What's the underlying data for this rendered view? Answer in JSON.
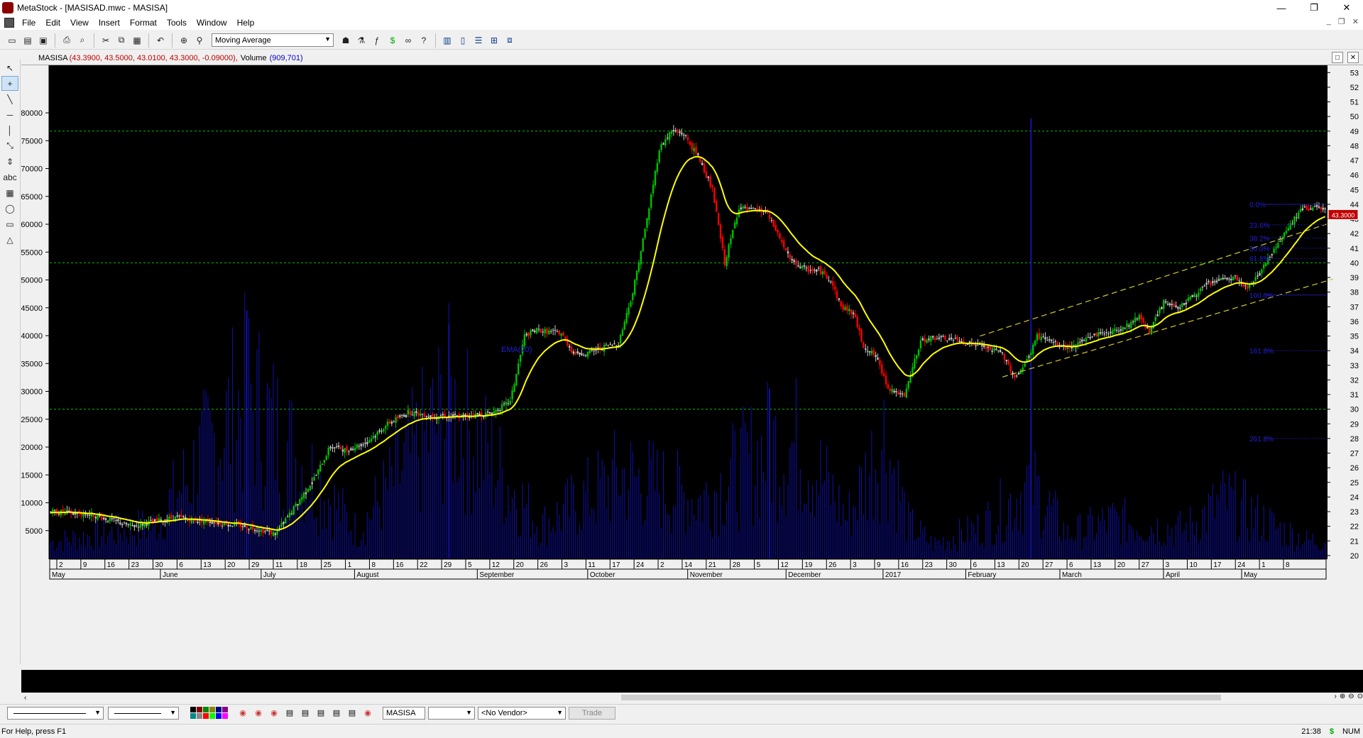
{
  "window": {
    "title": "MetaStock - [MASISAD.mwc - MASISA]",
    "controls": {
      "minimize": "—",
      "restore": "❐",
      "close": "✕"
    },
    "mdi_controls": [
      "_",
      "❐",
      "✕"
    ]
  },
  "menu": [
    "File",
    "Edit",
    "View",
    "Insert",
    "Format",
    "Tools",
    "Window",
    "Help"
  ],
  "toolbar": {
    "indicator_selected": "Moving Average",
    "buttons": [
      "new-icon",
      "open-icon",
      "save-icon",
      "print-icon",
      "print-preview-icon",
      "cut-icon",
      "copy-icon",
      "paste-icon",
      "undo-icon",
      "crosshair-icon",
      "zoom-icon",
      "expert-icon",
      "explorer-icon",
      "formula-icon",
      "dollar-icon",
      "binoculars-icon",
      "help-pointer-icon",
      "tile-icon",
      "window-split-icon",
      "window-horizontal-icon",
      "window-grid-icon",
      "window-cascade-icon"
    ]
  },
  "chart_header": {
    "symbol": "MASISA",
    "ohlc": "(43.3900, 43.5000, 43.0100, 43.3000, -0.09000),",
    "volume_label": "Volume",
    "volume_value": "(909,701)"
  },
  "chart_data": {
    "type": "candlestick",
    "symbol": "MASISA",
    "last_price_tag": "43.3000",
    "price_axis": {
      "ticks": [
        "53",
        "52",
        "51",
        "50",
        "49",
        "48",
        "47",
        "46",
        "45",
        "44",
        "43",
        "42",
        "41",
        "40",
        "39",
        "38",
        "37",
        "36",
        "35",
        "34",
        "33",
        "32",
        "31",
        "30",
        "29",
        "28",
        "27",
        "26",
        "25",
        "24",
        "23",
        "22",
        "21",
        "20"
      ]
    },
    "volume_axis": {
      "ticks": [
        "80000",
        "75000",
        "70000",
        "65000",
        "60000",
        "55000",
        "50000",
        "45000",
        "40000",
        "35000",
        "30000",
        "25000",
        "20000",
        "15000",
        "10000",
        "5000"
      ]
    },
    "horizontal_lines": [
      49,
      40,
      30
    ],
    "indicator_label": "EMA(20)",
    "fibonacci": [
      {
        "label": "0.0%",
        "value": 44.0
      },
      {
        "label": "23.6%",
        "value": 42.6
      },
      {
        "label": "38.2%",
        "value": 41.7
      },
      {
        "label": "50.0%",
        "value": 41.0
      },
      {
        "label": "61.8%",
        "value": 40.3
      },
      {
        "label": "100.0%",
        "value": 37.8
      },
      {
        "label": "161.8%",
        "value": 34.0
      },
      {
        "label": "261.8%",
        "value": 28.0
      }
    ],
    "x_axis": {
      "day_ticks": [
        "2",
        "9",
        "16",
        "23",
        "30",
        "6",
        "13",
        "20",
        "29",
        "11",
        "18",
        "25",
        "1",
        "8",
        "16",
        "22",
        "29",
        "5",
        "12",
        "20",
        "26",
        "3",
        "11",
        "17",
        "24",
        "2",
        "14",
        "21",
        "28",
        "5",
        "12",
        "19",
        "26",
        "3",
        "9",
        "16",
        "23",
        "30",
        "6",
        "13",
        "20",
        "27",
        "6",
        "13",
        "20",
        "27",
        "3",
        "10",
        "17",
        "24",
        "1",
        "8"
      ],
      "month_labels": [
        "May",
        "June",
        "July",
        "August",
        "September",
        "October",
        "November",
        "December",
        "2017",
        "February",
        "March",
        "April",
        "May"
      ]
    },
    "price_anchors": [
      [
        0,
        23.0
      ],
      [
        20,
        22.8
      ],
      [
        40,
        22.0
      ],
      [
        60,
        22.6
      ],
      [
        80,
        22.3
      ],
      [
        95,
        22.0
      ],
      [
        110,
        21.5
      ],
      [
        118,
        23.0
      ],
      [
        130,
        25.5
      ],
      [
        137,
        27.5
      ],
      [
        145,
        27.2
      ],
      [
        155,
        27.8
      ],
      [
        165,
        29.0
      ],
      [
        175,
        29.8
      ],
      [
        185,
        29.6
      ],
      [
        200,
        29.5
      ],
      [
        215,
        29.7
      ],
      [
        225,
        30.5
      ],
      [
        232,
        35.0
      ],
      [
        238,
        35.4
      ],
      [
        250,
        35.2
      ],
      [
        256,
        33.8
      ],
      [
        262,
        33.8
      ],
      [
        272,
        34.3
      ],
      [
        278,
        34.5
      ],
      [
        285,
        38.0
      ],
      [
        292,
        43.0
      ],
      [
        298,
        47.8
      ],
      [
        304,
        49.0
      ],
      [
        310,
        48.8
      ],
      [
        318,
        47.0
      ],
      [
        324,
        45.0
      ],
      [
        330,
        40.0
      ],
      [
        337,
        43.8
      ],
      [
        342,
        43.6
      ],
      [
        350,
        43.5
      ],
      [
        356,
        42.0
      ],
      [
        362,
        40.2
      ],
      [
        370,
        39.5
      ],
      [
        376,
        39.5
      ],
      [
        382,
        38.8
      ],
      [
        387,
        37.0
      ],
      [
        393,
        36.6
      ],
      [
        398,
        34.3
      ],
      [
        404,
        33.6
      ],
      [
        410,
        31.5
      ],
      [
        418,
        30.8
      ],
      [
        423,
        33.3
      ],
      [
        426,
        34.6
      ],
      [
        430,
        34.9
      ],
      [
        440,
        34.8
      ],
      [
        450,
        34.5
      ],
      [
        458,
        34.2
      ],
      [
        466,
        33.8
      ],
      [
        472,
        32.2
      ],
      [
        477,
        33.0
      ],
      [
        483,
        35.0
      ],
      [
        490,
        34.6
      ],
      [
        497,
        34.2
      ],
      [
        503,
        34.4
      ],
      [
        510,
        35.1
      ],
      [
        520,
        35.3
      ],
      [
        528,
        35.8
      ],
      [
        533,
        36.4
      ],
      [
        538,
        35.3
      ],
      [
        545,
        37.3
      ],
      [
        552,
        37.0
      ],
      [
        560,
        37.8
      ],
      [
        567,
        38.6
      ],
      [
        572,
        38.8
      ],
      [
        580,
        39.0
      ],
      [
        586,
        38.2
      ],
      [
        594,
        39.8
      ],
      [
        600,
        41.2
      ],
      [
        606,
        42.4
      ],
      [
        612,
        43.6
      ],
      [
        618,
        43.8
      ],
      [
        624,
        43.6
      ]
    ],
    "volume_anchors": [
      [
        0,
        4500
      ],
      [
        50,
        9000
      ],
      [
        96,
        44500
      ],
      [
        150,
        7500
      ],
      [
        195,
        42000
      ],
      [
        240,
        9000
      ],
      [
        280,
        23000
      ],
      [
        318,
        16000
      ],
      [
        352,
        30500
      ],
      [
        368,
        31000
      ],
      [
        390,
        11000
      ],
      [
        408,
        33500
      ],
      [
        420,
        9500
      ],
      [
        432,
        4000
      ],
      [
        455,
        8500
      ],
      [
        468,
        14500
      ],
      [
        480,
        21000
      ],
      [
        498,
        6500
      ],
      [
        520,
        10500
      ],
      [
        545,
        8500
      ],
      [
        555,
        8000
      ],
      [
        575,
        16000
      ],
      [
        600,
        8500
      ],
      [
        615,
        5000
      ]
    ],
    "ema_period": 20,
    "ema_color": "#ffff00",
    "bar_count": 625
  },
  "bottombar": {
    "symbol_field": "MASISA",
    "vendor_select": "<No Vendor>",
    "trade_label": "Trade"
  },
  "status": {
    "help_text": "For Help, press F1",
    "time": "21:38",
    "num": "NUM",
    "dollar": "$"
  }
}
